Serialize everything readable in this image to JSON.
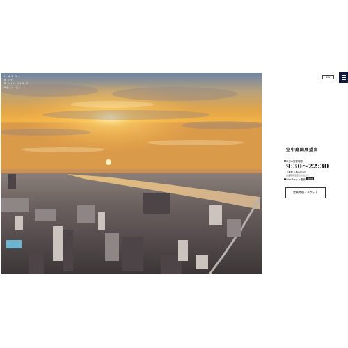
{
  "brand": {
    "title": "UMEDA SKY BUILDING",
    "subtitle": "梅田スカイビル"
  },
  "header": {
    "language_toggle": "EN",
    "menu_icon": "hamburger-menu-icon"
  },
  "hero": {
    "image_alt": "sunset-city-panorama"
  },
  "observatory": {
    "title": "空中庭園展望台",
    "hours_label": "本日の営業時間",
    "hours_time": "9:30〜22:30",
    "last_entry": "（最終入場22:00）",
    "note": "営業時間変更のお知らせ",
    "ticket_sale_label": "Webチケット販売",
    "ticket_badge": "受付中",
    "ticket_button": "営業時間・チケット"
  },
  "colors": {
    "menu_bg": "#10193a",
    "text": "#1a1a1a"
  }
}
